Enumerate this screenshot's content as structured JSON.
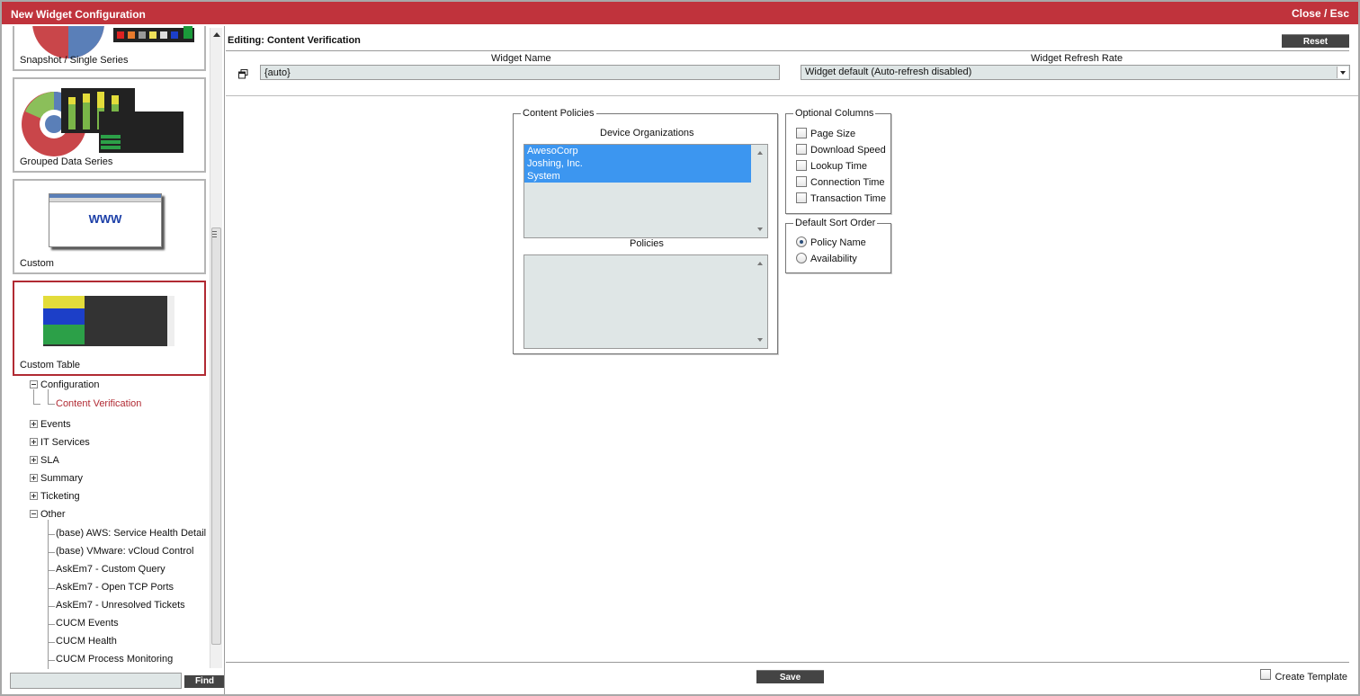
{
  "window": {
    "title": "New Widget Configuration",
    "close_label": "Close / Esc"
  },
  "sidebar": {
    "tiles": [
      {
        "label": "Snapshot / Single Series"
      },
      {
        "label": "Grouped Data Series"
      },
      {
        "label": "Custom",
        "thumb_text": "WWW"
      },
      {
        "label": "Custom Table",
        "selected": true
      }
    ],
    "tree": {
      "configuration": "Configuration",
      "content_verification": "Content Verification",
      "events": "Events",
      "it_services": "IT Services",
      "sla": "SLA",
      "summary": "Summary",
      "ticketing": "Ticketing",
      "other": "Other",
      "other_items": [
        "(base) AWS: Service Health Detail",
        "(base) VMware: vCloud Control",
        "AskEm7 - Custom Query",
        "AskEm7 - Open TCP Ports",
        "AskEm7 - Unresolved Tickets",
        "CUCM Events",
        "CUCM Health",
        "CUCM Process Monitoring"
      ]
    },
    "find_value": "",
    "find_label": "Find"
  },
  "main": {
    "editing_title": "Editing: Content Verification",
    "reset_label": "Reset",
    "widget_name_label": "Widget Name",
    "widget_name_value": "{auto}",
    "refresh_label": "Widget Refresh Rate",
    "refresh_value": "Widget default (Auto-refresh disabled)",
    "content_policies": {
      "legend": "Content Policies",
      "device_orgs_label": "Device Organizations",
      "device_orgs": [
        "AwesoCorp",
        "Joshing, Inc.",
        "System"
      ],
      "policies_label": "Policies"
    },
    "optional_columns": {
      "legend": "Optional Columns",
      "items": [
        "Page Size",
        "Download Speed",
        "Lookup Time",
        "Connection Time",
        "Transaction Time"
      ]
    },
    "sort_order": {
      "legend": "Default Sort Order",
      "options": [
        "Policy Name",
        "Availability"
      ],
      "selected": "Policy Name"
    },
    "save_label": "Save",
    "create_template_label": "Create Template"
  },
  "colors": {
    "titlebar": "#c0333c",
    "selection": "#3c96f0",
    "field_bg": "#dfe6e6",
    "button": "#444444"
  }
}
